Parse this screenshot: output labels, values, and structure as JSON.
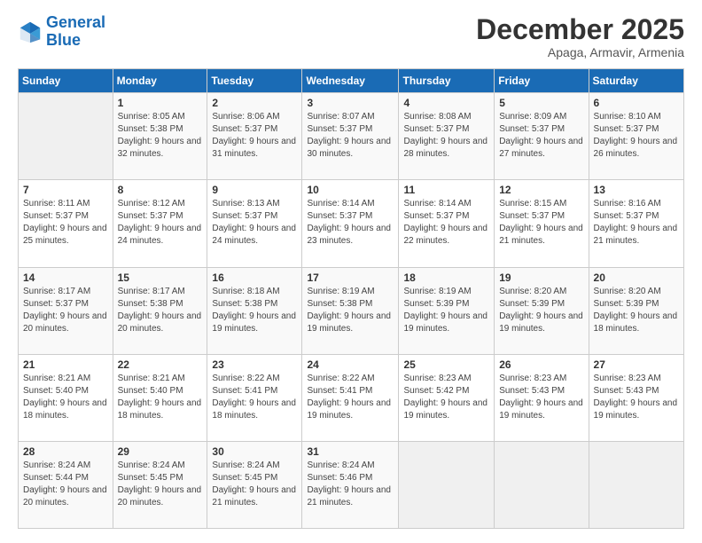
{
  "logo": {
    "line1": "General",
    "line2": "Blue"
  },
  "title": "December 2025",
  "location": "Apaga, Armavir, Armenia",
  "days_header": [
    "Sunday",
    "Monday",
    "Tuesday",
    "Wednesday",
    "Thursday",
    "Friday",
    "Saturday"
  ],
  "weeks": [
    [
      {
        "day": "",
        "sunrise": "",
        "sunset": "",
        "daylight": ""
      },
      {
        "day": "1",
        "sunrise": "Sunrise: 8:05 AM",
        "sunset": "Sunset: 5:38 PM",
        "daylight": "Daylight: 9 hours and 32 minutes."
      },
      {
        "day": "2",
        "sunrise": "Sunrise: 8:06 AM",
        "sunset": "Sunset: 5:37 PM",
        "daylight": "Daylight: 9 hours and 31 minutes."
      },
      {
        "day": "3",
        "sunrise": "Sunrise: 8:07 AM",
        "sunset": "Sunset: 5:37 PM",
        "daylight": "Daylight: 9 hours and 30 minutes."
      },
      {
        "day": "4",
        "sunrise": "Sunrise: 8:08 AM",
        "sunset": "Sunset: 5:37 PM",
        "daylight": "Daylight: 9 hours and 28 minutes."
      },
      {
        "day": "5",
        "sunrise": "Sunrise: 8:09 AM",
        "sunset": "Sunset: 5:37 PM",
        "daylight": "Daylight: 9 hours and 27 minutes."
      },
      {
        "day": "6",
        "sunrise": "Sunrise: 8:10 AM",
        "sunset": "Sunset: 5:37 PM",
        "daylight": "Daylight: 9 hours and 26 minutes."
      }
    ],
    [
      {
        "day": "7",
        "sunrise": "Sunrise: 8:11 AM",
        "sunset": "Sunset: 5:37 PM",
        "daylight": "Daylight: 9 hours and 25 minutes."
      },
      {
        "day": "8",
        "sunrise": "Sunrise: 8:12 AM",
        "sunset": "Sunset: 5:37 PM",
        "daylight": "Daylight: 9 hours and 24 minutes."
      },
      {
        "day": "9",
        "sunrise": "Sunrise: 8:13 AM",
        "sunset": "Sunset: 5:37 PM",
        "daylight": "Daylight: 9 hours and 24 minutes."
      },
      {
        "day": "10",
        "sunrise": "Sunrise: 8:14 AM",
        "sunset": "Sunset: 5:37 PM",
        "daylight": "Daylight: 9 hours and 23 minutes."
      },
      {
        "day": "11",
        "sunrise": "Sunrise: 8:14 AM",
        "sunset": "Sunset: 5:37 PM",
        "daylight": "Daylight: 9 hours and 22 minutes."
      },
      {
        "day": "12",
        "sunrise": "Sunrise: 8:15 AM",
        "sunset": "Sunset: 5:37 PM",
        "daylight": "Daylight: 9 hours and 21 minutes."
      },
      {
        "day": "13",
        "sunrise": "Sunrise: 8:16 AM",
        "sunset": "Sunset: 5:37 PM",
        "daylight": "Daylight: 9 hours and 21 minutes."
      }
    ],
    [
      {
        "day": "14",
        "sunrise": "Sunrise: 8:17 AM",
        "sunset": "Sunset: 5:37 PM",
        "daylight": "Daylight: 9 hours and 20 minutes."
      },
      {
        "day": "15",
        "sunrise": "Sunrise: 8:17 AM",
        "sunset": "Sunset: 5:38 PM",
        "daylight": "Daylight: 9 hours and 20 minutes."
      },
      {
        "day": "16",
        "sunrise": "Sunrise: 8:18 AM",
        "sunset": "Sunset: 5:38 PM",
        "daylight": "Daylight: 9 hours and 19 minutes."
      },
      {
        "day": "17",
        "sunrise": "Sunrise: 8:19 AM",
        "sunset": "Sunset: 5:38 PM",
        "daylight": "Daylight: 9 hours and 19 minutes."
      },
      {
        "day": "18",
        "sunrise": "Sunrise: 8:19 AM",
        "sunset": "Sunset: 5:39 PM",
        "daylight": "Daylight: 9 hours and 19 minutes."
      },
      {
        "day": "19",
        "sunrise": "Sunrise: 8:20 AM",
        "sunset": "Sunset: 5:39 PM",
        "daylight": "Daylight: 9 hours and 19 minutes."
      },
      {
        "day": "20",
        "sunrise": "Sunrise: 8:20 AM",
        "sunset": "Sunset: 5:39 PM",
        "daylight": "Daylight: 9 hours and 18 minutes."
      }
    ],
    [
      {
        "day": "21",
        "sunrise": "Sunrise: 8:21 AM",
        "sunset": "Sunset: 5:40 PM",
        "daylight": "Daylight: 9 hours and 18 minutes."
      },
      {
        "day": "22",
        "sunrise": "Sunrise: 8:21 AM",
        "sunset": "Sunset: 5:40 PM",
        "daylight": "Daylight: 9 hours and 18 minutes."
      },
      {
        "day": "23",
        "sunrise": "Sunrise: 8:22 AM",
        "sunset": "Sunset: 5:41 PM",
        "daylight": "Daylight: 9 hours and 18 minutes."
      },
      {
        "day": "24",
        "sunrise": "Sunrise: 8:22 AM",
        "sunset": "Sunset: 5:41 PM",
        "daylight": "Daylight: 9 hours and 19 minutes."
      },
      {
        "day": "25",
        "sunrise": "Sunrise: 8:23 AM",
        "sunset": "Sunset: 5:42 PM",
        "daylight": "Daylight: 9 hours and 19 minutes."
      },
      {
        "day": "26",
        "sunrise": "Sunrise: 8:23 AM",
        "sunset": "Sunset: 5:43 PM",
        "daylight": "Daylight: 9 hours and 19 minutes."
      },
      {
        "day": "27",
        "sunrise": "Sunrise: 8:23 AM",
        "sunset": "Sunset: 5:43 PM",
        "daylight": "Daylight: 9 hours and 19 minutes."
      }
    ],
    [
      {
        "day": "28",
        "sunrise": "Sunrise: 8:24 AM",
        "sunset": "Sunset: 5:44 PM",
        "daylight": "Daylight: 9 hours and 20 minutes."
      },
      {
        "day": "29",
        "sunrise": "Sunrise: 8:24 AM",
        "sunset": "Sunset: 5:45 PM",
        "daylight": "Daylight: 9 hours and 20 minutes."
      },
      {
        "day": "30",
        "sunrise": "Sunrise: 8:24 AM",
        "sunset": "Sunset: 5:45 PM",
        "daylight": "Daylight: 9 hours and 21 minutes."
      },
      {
        "day": "31",
        "sunrise": "Sunrise: 8:24 AM",
        "sunset": "Sunset: 5:46 PM",
        "daylight": "Daylight: 9 hours and 21 minutes."
      },
      {
        "day": "",
        "sunrise": "",
        "sunset": "",
        "daylight": ""
      },
      {
        "day": "",
        "sunrise": "",
        "sunset": "",
        "daylight": ""
      },
      {
        "day": "",
        "sunrise": "",
        "sunset": "",
        "daylight": ""
      }
    ]
  ]
}
